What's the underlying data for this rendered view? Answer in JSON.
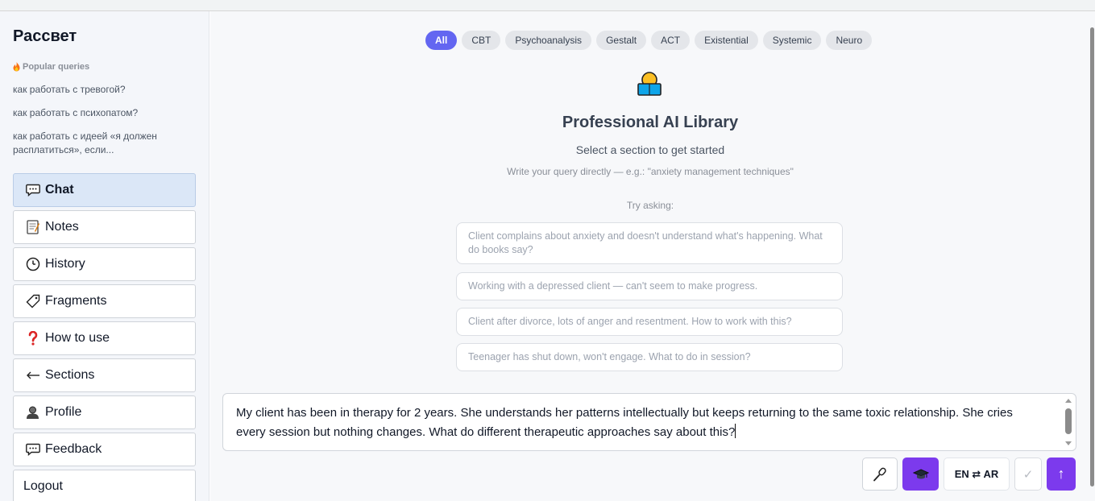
{
  "sidebar": {
    "brand": "Рассвет",
    "popular_title": "Popular queries",
    "queries": [
      "как работать с тревогой?",
      "как работать с психопатом?",
      "как работать с идеей «я должен расплатиться», если..."
    ],
    "nav": [
      {
        "label": "Chat",
        "icon": "chat-bubble-icon",
        "active": true
      },
      {
        "label": "Notes",
        "icon": "memo-icon"
      },
      {
        "label": "History",
        "icon": "clock-icon"
      },
      {
        "label": "Fragments",
        "icon": "tag-icon"
      },
      {
        "label": "How to use",
        "icon": "question-icon"
      },
      {
        "label": "Sections",
        "icon": "arrow-left-icon"
      },
      {
        "label": "Profile",
        "icon": "user-icon"
      },
      {
        "label": "Feedback",
        "icon": "chat-bubble-icon"
      },
      {
        "label": "Logout",
        "icon": ""
      }
    ]
  },
  "filters": [
    "All",
    "CBT",
    "Psychoanalysis",
    "Gestalt",
    "ACT",
    "Existential",
    "Systemic",
    "Neuro"
  ],
  "hero": {
    "title": "Professional AI Library",
    "subtitle": "Select a section to get started",
    "hint": "Write your query directly — e.g.: \"anxiety management techniques\"",
    "try_label": "Try asking:"
  },
  "suggestions": [
    "Client complains about anxiety and doesn't understand what's happening. What do books say?",
    "Working with a depressed client — can't seem to make progress.",
    "Client after divorce, lots of anger and resentment. How to work with this?",
    "Teenager has shut down, won't engage. What to do in session?"
  ],
  "composer": {
    "text": "My client has been in therapy for 2 years. She understands her patterns intellectually but keeps returning to the same toxic relationship. She cries every session but nothing changes. What do different therapeutic approaches say about this?",
    "lang_label": "EN ⇄ AR",
    "check_label": "✓",
    "send_label": "↑"
  },
  "colors": {
    "accent": "#6366f1",
    "purple": "#7c3aed",
    "active_nav": "#dbe7f7"
  }
}
